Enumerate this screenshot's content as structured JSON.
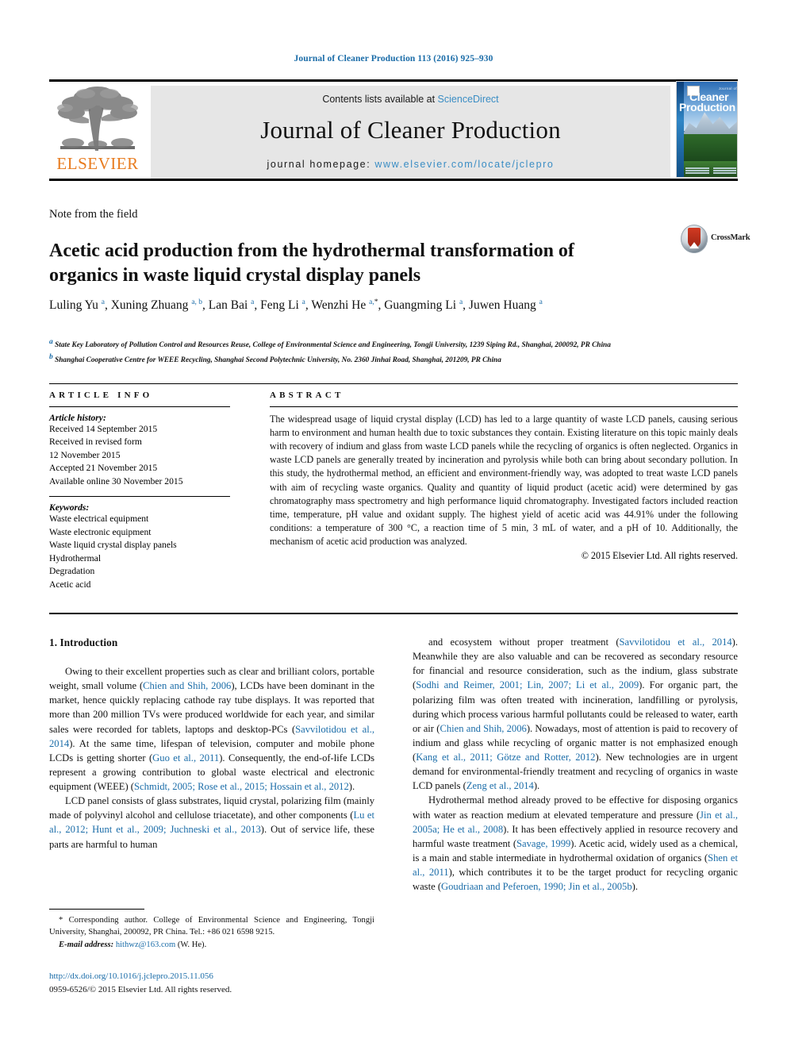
{
  "running_head": "Journal of Cleaner Production 113 (2016) 925–930",
  "masthead": {
    "contents_prefix": "Contents lists available at ",
    "sciencedirect": "ScienceDirect",
    "journal_name": "Journal of Cleaner Production",
    "homepage_prefix": "journal homepage: ",
    "homepage_url": "www.elsevier.com/locate/jclepro",
    "elsevier_wordmark": "ELSEVIER",
    "cover": {
      "kicker": "Journal of",
      "line1": "Cleaner",
      "line2": "Production"
    },
    "colors": {
      "link": "#3a8dc4",
      "elsevier_orange": "#E87B1E",
      "band_bg": "#e6e6e6"
    }
  },
  "article": {
    "type": "Note from the field",
    "title": "Acetic acid production from the hydrothermal transformation of organics in waste liquid crystal display panels",
    "crossmark_label": "CrossMark",
    "authors_html": "Luling Yu <sup>a</sup>, Xuning Zhuang <sup>a, b</sup>, Lan Bai <sup>a</sup>, Feng Li <sup>a</sup>, Wenzhi He <sup>a,</sup><sup class=\"star\">*</sup>, Guangming Li <sup>a</sup>, Juwen Huang <sup>a</sup>",
    "affiliations": [
      "State Key Laboratory of Pollution Control and Resources Reuse, College of Environmental Science and Engineering, Tongji University, 1239 Siping Rd., Shanghai, 200092, PR China",
      "Shanghai Cooperative Centre for WEEE Recycling, Shanghai Second Polytechnic University, No. 2360 Jinhai Road, Shanghai, 201209, PR China"
    ],
    "affiliation_marks": [
      "a",
      "b"
    ]
  },
  "info": {
    "heading": "ARTICLE INFO",
    "history_label": "Article history:",
    "history": [
      "Received 14 September 2015",
      "Received in revised form",
      "12 November 2015",
      "Accepted 21 November 2015",
      "Available online 30 November 2015"
    ],
    "keywords_label": "Keywords:",
    "keywords": [
      "Waste electrical equipment",
      "Waste electronic equipment",
      "Waste liquid crystal display panels",
      "Hydrothermal",
      "Degradation",
      "Acetic acid"
    ]
  },
  "abstract": {
    "heading": "ABSTRACT",
    "text": "The widespread usage of liquid crystal display (LCD) has led to a large quantity of waste LCD panels, causing serious harm to environment and human health due to toxic substances they contain. Existing literature on this topic mainly deals with recovery of indium and glass from waste LCD panels while the recycling of organics is often neglected. Organics in waste LCD panels are generally treated by incineration and pyrolysis while both can bring about secondary pollution. In this study, the hydrothermal method, an efficient and environment-friendly way, was adopted to treat waste LCD panels with aim of recycling waste organics. Quality and quantity of liquid product (acetic acid) were determined by gas chromatography mass spectrometry and high performance liquid chromatography. Investigated factors included reaction time, temperature, pH value and oxidant supply. The highest yield of acetic acid was 44.91% under the following conditions: a temperature of 300 °C, a reaction time of 5 min, 3 mL of water, and a pH of 10. Additionally, the mechanism of acetic acid production was analyzed.",
    "copyright": "© 2015 Elsevier Ltd. All rights reserved."
  },
  "body": {
    "section_number_title": "1. Introduction",
    "left_paragraphs_html": [
      "Owing to their excellent properties such as clear and brilliant colors, portable weight, small volume (<span class=\"lnk\">Chien and Shih, 2006</span>), LCDs have been dominant in the market, hence quickly replacing cathode ray tube displays. It was reported that more than 200 million TVs were produced worldwide for each year, and similar sales were recorded for tablets, laptops and desktop-PCs (<span class=\"lnk\">Savvilotidou et al., 2014</span>). At the same time, lifespan of television, computer and mobile phone LCDs is getting shorter (<span class=\"lnk\">Guo et al., 2011</span>). Consequently, the end-of-life LCDs represent a growing contribution to global waste electrical and electronic equipment (WEEE) (<span class=\"lnk\">Schmidt, 2005; Rose et al., 2015; Hossain et al., 2012</span>).",
      "LCD panel consists of glass substrates, liquid crystal, polarizing film (mainly made of polyvinyl alcohol and cellulose triacetate), and other components (<span class=\"lnk\">Lu et al., 2012; Hunt et al., 2009; Juchneski et al., 2013</span>). Out of service life, these parts are harmful to human"
    ],
    "right_paragraphs_html": [
      "and ecosystem without proper treatment (<span class=\"lnk\">Savvilotidou et al., 2014</span>). Meanwhile they are also valuable and can be recovered as secondary resource for financial and resource consideration, such as the indium, glass substrate (<span class=\"lnk\">Sodhi and Reimer, 2001; Lin, 2007; Li et al., 2009</span>). For organic part, the polarizing film was often treated with incineration, landfilling or pyrolysis, during which process various harmful pollutants could be released to water, earth or air (<span class=\"lnk\">Chien and Shih, 2006</span>). Nowadays, most of attention is paid to recovery of indium and glass while recycling of organic matter is not emphasized enough (<span class=\"lnk\">Kang et al., 2011; Götze and Rotter, 2012</span>). New technologies are in urgent demand for environmental-friendly treatment and recycling of organics in waste LCD panels (<span class=\"lnk\">Zeng et al., 2014</span>).",
      "Hydrothermal method already proved to be effective for disposing organics with water as reaction medium at elevated temperature and pressure (<span class=\"lnk\">Jin et al., 2005a; He et al., 2008</span>). It has been effectively applied in resource recovery and harmful waste treatment (<span class=\"lnk\">Savage, 1999</span>). Acetic acid, widely used as a chemical, is a main and stable intermediate in hydrothermal oxidation of organics (<span class=\"lnk\">Shen et al., 2011</span>), which contributes it to be the target product for recycling organic waste (<span class=\"lnk\">Goudriaan and Peferoen, 1990; Jin et al., 2005b</span>)."
    ]
  },
  "footnote": {
    "corresponding_html": "* Corresponding author. College of Environmental Science and Engineering, Tongji University, Shanghai, 200092, PR China. Tel.: +86 021 6598 9215.",
    "email_label": "E-mail address:",
    "email": "hithwz@163.com",
    "email_suffix": "(W. He)."
  },
  "doi": {
    "url": "http://dx.doi.org/10.1016/j.jclepro.2015.11.056",
    "issn_line": "0959-6526/© 2015 Elsevier Ltd. All rights reserved."
  }
}
